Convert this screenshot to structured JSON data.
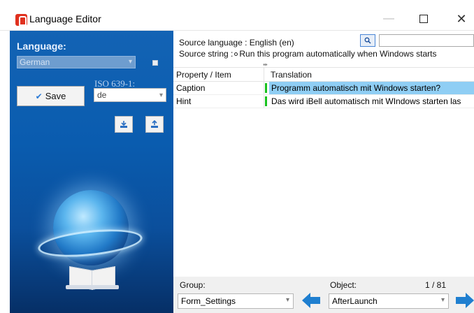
{
  "window": {
    "title": "Language Editor",
    "controls": {
      "minimize": "—",
      "close": "✕"
    }
  },
  "left_panel": {
    "language_label": "Language:",
    "language_value": "German",
    "save_label": "Save",
    "iso_label": "ISO 639-1:",
    "iso_value": "de"
  },
  "source": {
    "language_text": "Source language : English (en)",
    "string_label": "Source string :",
    "string_value": "Run this program automatically when Windows starts"
  },
  "grid": {
    "columns": [
      "Property / Item",
      "Translation"
    ],
    "rows": [
      {
        "property": "Caption",
        "translation": "Programm automatisch mit Windows starten?",
        "selected": true
      },
      {
        "property": "Hint",
        "translation": "Das wird iBell automatisch mit WIndows starten las",
        "selected": false
      }
    ]
  },
  "footer": {
    "group_label": "Group:",
    "group_value": "Form_Settings",
    "object_label": "Object:",
    "object_value": "AfterLaunch",
    "counter": "1 / 81"
  },
  "colors": {
    "panel_blue": "#0a5caf",
    "selection": "#8fcef4",
    "status_green": "#18c21e",
    "arrow_blue": "#1f7fd0",
    "app_red": "#e0311f"
  },
  "icons": {
    "app": "language-editor-app-icon",
    "search": "magnifier-icon",
    "prev": "left-arrow-icon",
    "next": "right-arrow-icon",
    "import": "import-icon",
    "export": "export-icon"
  }
}
